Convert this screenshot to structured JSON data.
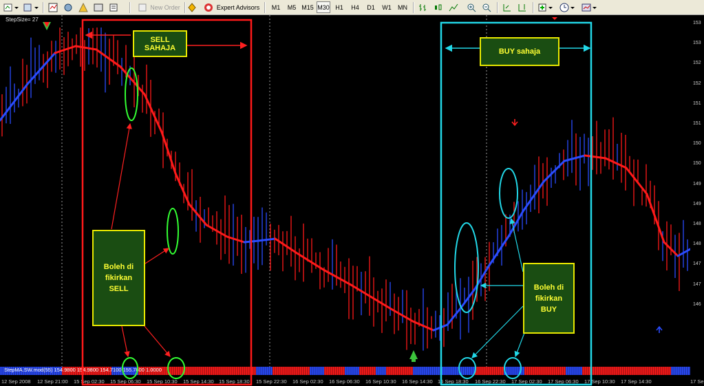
{
  "toolbar": {
    "new_order_label": "New Order",
    "expert_advisors_label": "Expert Advisors",
    "timeframes": [
      "M1",
      "M5",
      "M15",
      "M30",
      "H1",
      "H4",
      "D1",
      "W1",
      "MN"
    ],
    "active_timeframe": "M30"
  },
  "chart": {
    "stepsize_label": "StepSize= 27",
    "indicator_label": "StepMA.SW.mod(55) 154.9800 154.9800 154.7100 155.7800 1.0000",
    "price_labels": [
      "153",
      "153",
      "152",
      "152",
      "151",
      "151",
      "150",
      "150",
      "149",
      "149",
      "148",
      "148",
      "147",
      "147",
      "146"
    ],
    "time_labels": [
      "12 Sep 2008",
      "12 Sep 21:00",
      "15 Sep 02:30",
      "15 Sep 06:30",
      "15 Sep 10:30",
      "15 Sep 14:30",
      "15 Sep 18:30",
      "15 Sep 22:30",
      "16 Sep 02:30",
      "16 Sep 06:30",
      "16 Sep 10:30",
      "16 Sep 14:30",
      "16 Sep 18:30",
      "16 Sep 22:30",
      "17 Sep 02:30",
      "17 Sep 06:30",
      "17 Sep 10:30",
      "17 Sep 14:30",
      "17 Se"
    ],
    "colors": {
      "up": "#2a4cff",
      "down": "#ff1a1a",
      "sell_frame": "#ff1a1a",
      "buy_frame": "#22d8e8",
      "highlight_sell": "#33ff33"
    }
  },
  "annotations": {
    "sell_zone": "SELL SAHAJA",
    "buy_zone": "BUY sahaja",
    "sell_note": "Boleh di fikirkan SELL",
    "buy_note": "Boleh di fikirkan BUY"
  }
}
